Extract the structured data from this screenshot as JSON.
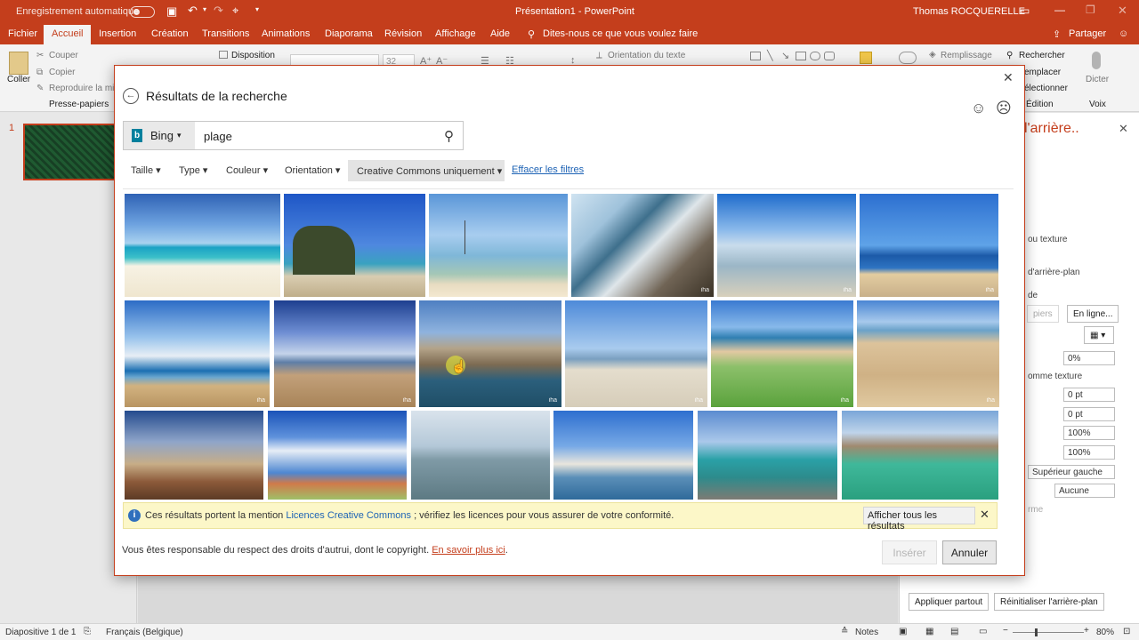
{
  "app": {
    "window_title": "Présentation1  -  PowerPoint",
    "autosave_label": "Enregistrement automatique",
    "user_name": "Thomas ROCQUERELLE"
  },
  "ribbon_tabs": [
    "Fichier",
    "Accueil",
    "Insertion",
    "Création",
    "Transitions",
    "Animations",
    "Diaporama",
    "Révision",
    "Affichage",
    "Aide"
  ],
  "tell_me": "Dites-nous ce que vous voulez faire",
  "share_label": "Partager",
  "ribbon": {
    "paste": "Coller",
    "cut": "Couper",
    "copy": "Copier",
    "format_painter": "Reproduire la mise",
    "clipboard_group": "Presse-papiers",
    "layout": "Disposition",
    "font_size": "32",
    "text_orientation": "Orientation du texte",
    "fill": "Remplissage",
    "find": "Rechercher",
    "replace": "emplacer",
    "select": "électionner",
    "editing_group": "Édition",
    "dictate": "Dicter",
    "voice_group": "Voix"
  },
  "slide_pane": {
    "slide_number": "1"
  },
  "format_pane": {
    "title": "l'arrière..",
    "texture": "ou texture",
    "hide_bg": "d'arrière-plan",
    "de": "de",
    "papers_btn": "piers",
    "online_btn": "En ligne...",
    "transparency": "0%",
    "tile_texture": "omme texture",
    "offset_x": "0 pt",
    "offset_y": "0 pt",
    "scale_x": "100%",
    "scale_y": "100%",
    "alignment": "Supérieur gauche",
    "mirror": "Aucune",
    "rme": "rme",
    "apply_all": "Appliquer partout",
    "reset_bg": "Réinitialiser l'arrière-plan"
  },
  "status_bar": {
    "slide_info": "Diapositive 1 de 1",
    "language": "Français (Belgique)",
    "notes": "Notes",
    "zoom": "80%"
  },
  "dialog": {
    "title": "Résultats de la recherche",
    "search_provider": "Bing",
    "search_query": "plage",
    "filters": [
      "Taille",
      "Type",
      "Couleur",
      "Orientation"
    ],
    "cc_filter": "Creative Commons uniquement",
    "clear_filters": "Effacer les filtres",
    "info_text_1": "Ces résultats portent la mention",
    "info_link": "Licences Creative Commons",
    "info_text_2": "; vérifiez les licences pour vous assurer de votre conformité.",
    "show_all": "Afficher tous les résultats",
    "footer_text": "Vous êtes responsable du respect des droits d'autrui, dont le copyright.",
    "footer_link": "En savoir plus ici",
    "footer_end": ".",
    "insert": "Insérer",
    "cancel": "Annuler",
    "watermark": "iha"
  },
  "colors": {
    "accent": "#c43e1c",
    "link": "#1e63b5",
    "info_bg": "#fcf7c8",
    "bing": "#00809d"
  }
}
